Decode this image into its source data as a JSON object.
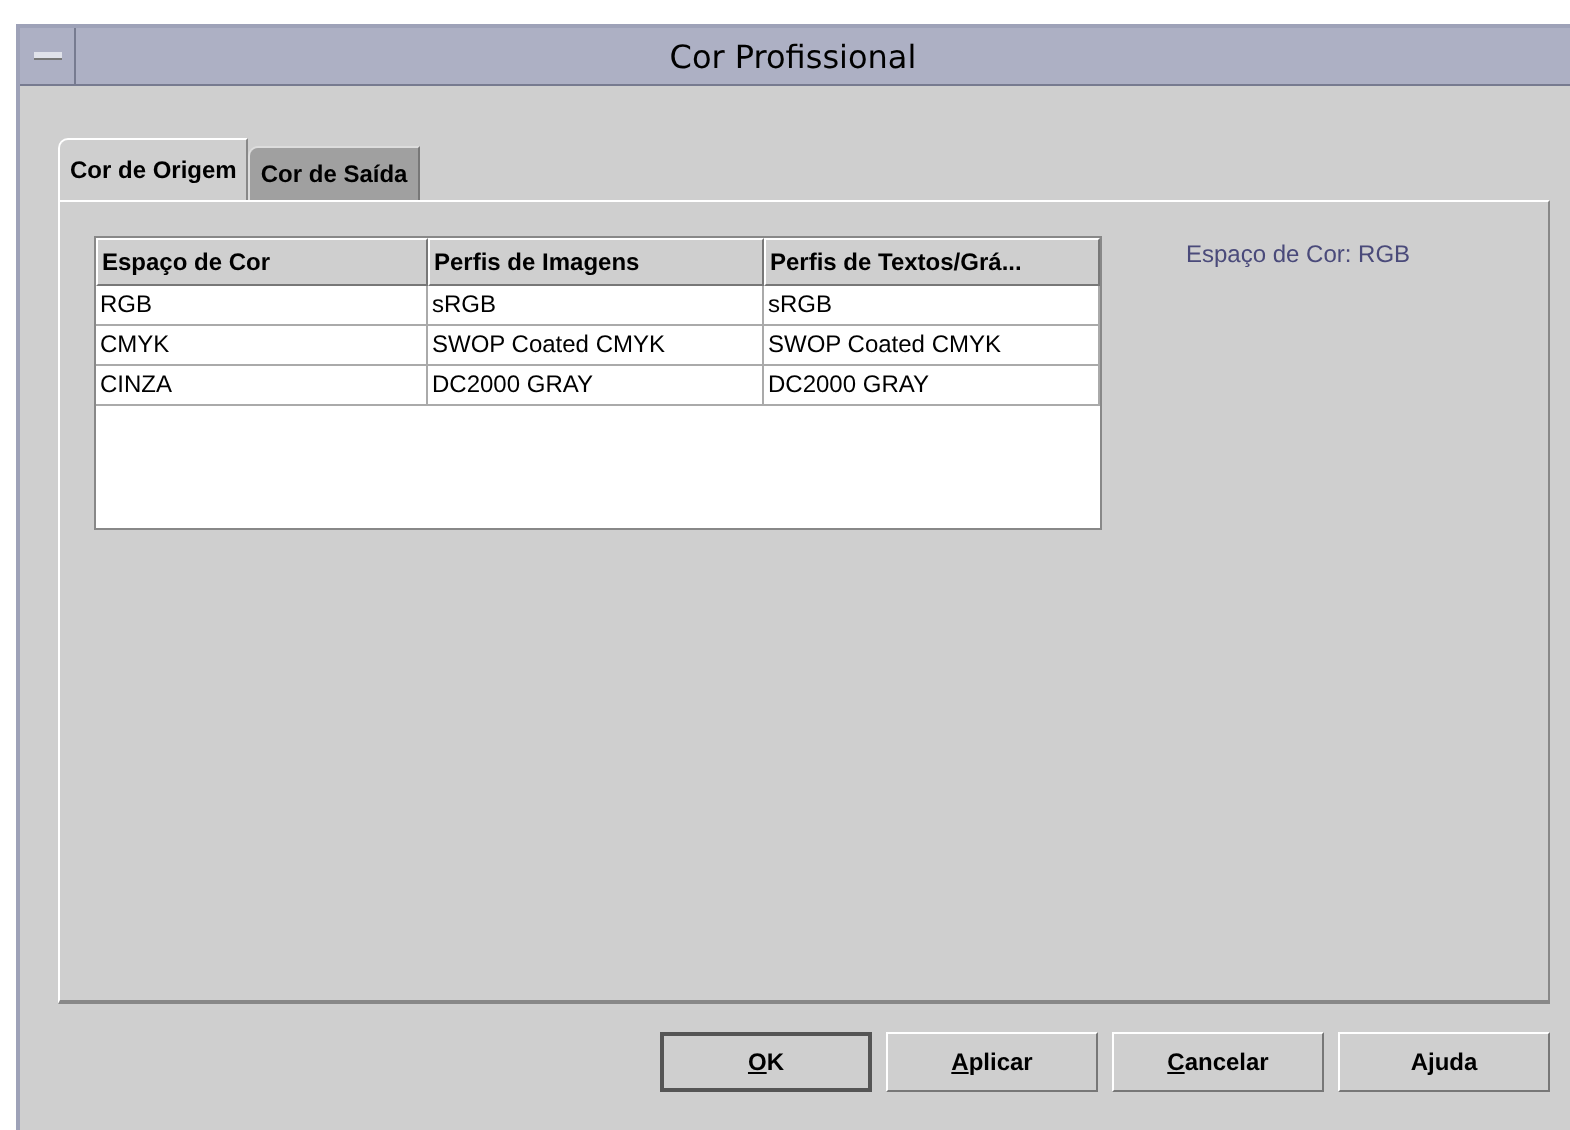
{
  "window": {
    "title": "Cor Profissional"
  },
  "tabs": [
    {
      "label": "Cor de Origem",
      "selected": true
    },
    {
      "label": "Cor de Saída",
      "selected": false
    }
  ],
  "table": {
    "columns": [
      "Espaço de Cor",
      "Perfis de Imagens",
      "Perfis de Textos/Grá..."
    ],
    "rows": [
      [
        "RGB",
        "sRGB",
        "sRGB"
      ],
      [
        "CMYK",
        "SWOP Coated CMYK",
        "SWOP Coated CMYK"
      ],
      [
        "CINZA",
        "DC2000 GRAY",
        "DC2000 GRAY"
      ]
    ]
  },
  "info": "Espaço de Cor: RGB",
  "buttons": [
    {
      "label": "OK",
      "underline_first": true,
      "default": true
    },
    {
      "label": "Aplicar",
      "underline_first": true,
      "default": false
    },
    {
      "label": "Cancelar",
      "underline_first": true,
      "default": false
    },
    {
      "label": "Ajuda",
      "underline_first": false,
      "default": false
    }
  ]
}
